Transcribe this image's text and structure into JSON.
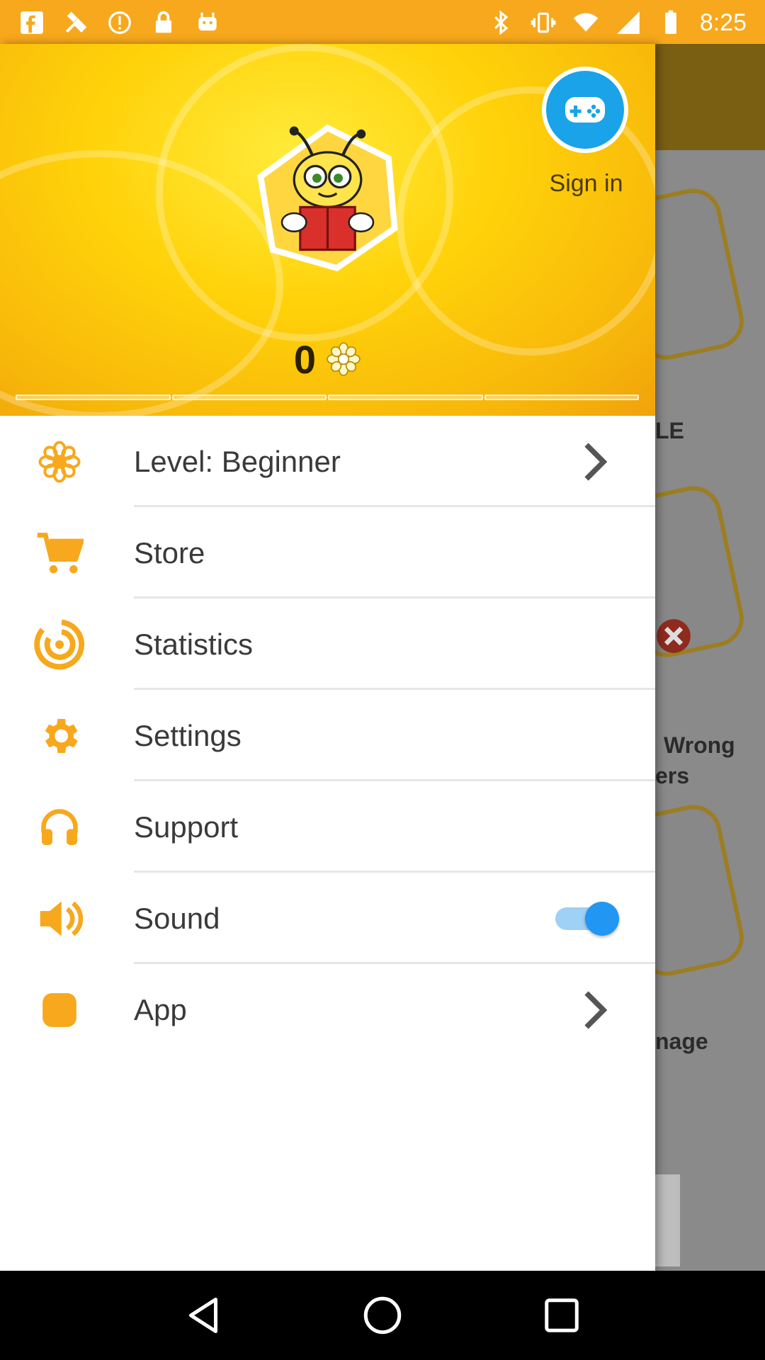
{
  "status_bar": {
    "time": "8:25",
    "left_icons": [
      "facebook-icon",
      "fake-gps-icon",
      "info-icon",
      "lock-icon",
      "android-icon"
    ],
    "right_icons": [
      "bluetooth-icon",
      "vibrate-icon",
      "wifi-icon",
      "signal-icon",
      "battery-icon"
    ]
  },
  "background_app": {
    "partial_texts": [
      "LE",
      "Wrong",
      "ers",
      "nage"
    ]
  },
  "drawer": {
    "header": {
      "sign_in_label": "Sign in",
      "score": "0",
      "progress_segments": 4
    },
    "menu": [
      {
        "label": "Level: Beginner",
        "icon": "flower-icon",
        "trailing": "chevron"
      },
      {
        "label": "Store",
        "icon": "cart-icon",
        "trailing": "none"
      },
      {
        "label": "Statistics",
        "icon": "spiral-icon",
        "trailing": "none"
      },
      {
        "label": "Settings",
        "icon": "gear-icon",
        "trailing": "none"
      },
      {
        "label": "Support",
        "icon": "headphones-icon",
        "trailing": "none"
      },
      {
        "label": "Sound",
        "icon": "speaker-icon",
        "trailing": "toggle",
        "toggle_on": true
      },
      {
        "label": "App",
        "icon": "app-square-icon",
        "trailing": "chevron"
      }
    ]
  },
  "colors": {
    "status_bar": "#f7a81c",
    "accent_orange": "#f7a81c",
    "game_button": "#1aa3e8",
    "toggle_on": "#2196f3",
    "menu_text": "#3a3a3a"
  }
}
